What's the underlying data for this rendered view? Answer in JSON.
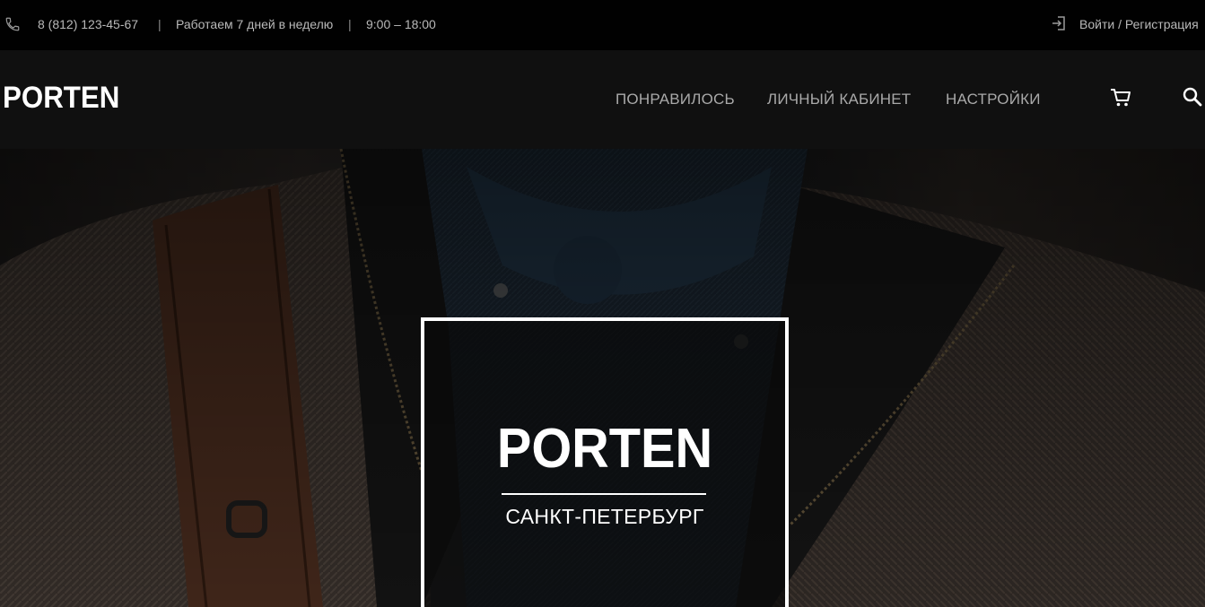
{
  "topbar": {
    "phone": "8 (812) 123-45-67",
    "separator": "|",
    "schedule": "Работаем 7 дней в неделю",
    "hours": "9:00 – 18:00",
    "auth": "Войти / Регистрация",
    "phone_icon": "phone-icon",
    "login_icon": "login-icon"
  },
  "nav": {
    "logo": "PORTEN",
    "links": [
      "ПОНРАВИЛОСЬ",
      "ЛИЧНЫЙ КАБИНЕТ",
      "НАСТРОЙКИ"
    ],
    "cart_icon": "cart-icon",
    "search_icon": "search-icon"
  },
  "hero": {
    "brand": "PORTEN",
    "city": "САНКТ-ПЕТЕРБУРГ"
  },
  "colors": {
    "topbar_bg": "#010101",
    "nav_bg": "#101010",
    "nav_text": "#a9a9a9",
    "accent_white": "#ffffff"
  }
}
